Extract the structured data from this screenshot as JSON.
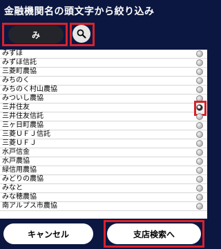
{
  "header": {
    "title": "金融機関名の頭文字から絞り込み"
  },
  "filter": {
    "kana_value": "み",
    "search_icon": "search-icon"
  },
  "list": {
    "items": [
      {
        "label": "みずほ",
        "selected": false
      },
      {
        "label": "みずほ信託",
        "selected": false
      },
      {
        "label": "三菱町農協",
        "selected": false
      },
      {
        "label": "みちのく",
        "selected": false
      },
      {
        "label": "みちのく村山農協",
        "selected": false
      },
      {
        "label": "みついし農協",
        "selected": false
      },
      {
        "label": "三井住友",
        "selected": true
      },
      {
        "label": "三井住友信託",
        "selected": false
      },
      {
        "label": "三ヶ日町農協",
        "selected": false
      },
      {
        "label": "三菱ＵＦＪ信託",
        "selected": false
      },
      {
        "label": "三菱ＵＦＪ",
        "selected": false
      },
      {
        "label": "水戸信金",
        "selected": false
      },
      {
        "label": "水戸農協",
        "selected": false
      },
      {
        "label": "緑信用農協",
        "selected": false
      },
      {
        "label": "みどりの農協",
        "selected": false
      },
      {
        "label": "みなと",
        "selected": false
      },
      {
        "label": "みな穂農協",
        "selected": false
      },
      {
        "label": "南アルプス市農協",
        "selected": false
      }
    ]
  },
  "footer": {
    "cancel_label": "キャンセル",
    "branch_search_label": "支店検索へ"
  },
  "colors": {
    "background": "#0b1740",
    "highlight": "#d8222b"
  }
}
